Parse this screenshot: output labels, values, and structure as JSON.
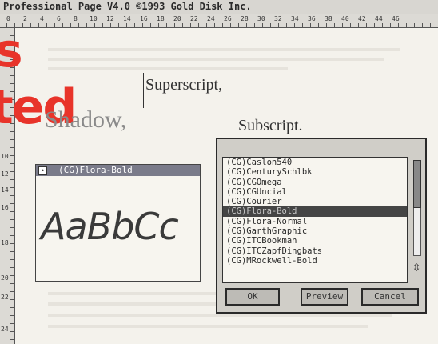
{
  "app_title": "Professional Page V4.0 ©1993 Gold Disk Inc.",
  "ruler": {
    "horizontal": [
      "0",
      "2",
      "4",
      "6",
      "8",
      "10",
      "12",
      "14",
      "16",
      "18",
      "20",
      "22",
      "24",
      "26",
      "28",
      "30",
      "32",
      "34",
      "36",
      "38",
      "40",
      "42",
      "44",
      "46"
    ],
    "vertical": [
      "10",
      "12",
      "14",
      "16",
      "18",
      "20",
      "22",
      "24"
    ]
  },
  "headline": {
    "line1": "s",
    "line2": "ted"
  },
  "document": {
    "shadow": "Shadow,",
    "superscript": "Superscript,",
    "subscript": "Subscript."
  },
  "font_window": {
    "close": "•",
    "title": "(CG)Flora-Bold",
    "sample": "AaBbCc"
  },
  "font_dialog": {
    "fonts": [
      {
        "name": "(CG)Caslon540"
      },
      {
        "name": "(CG)CenturySchlbk"
      },
      {
        "name": "(CG)CGOmega"
      },
      {
        "name": "(CG)CGUncial"
      },
      {
        "name": "(CG)Courier"
      },
      {
        "name": "(CG)Flora-Bold",
        "selected": true
      },
      {
        "name": "(CG)Flora-Normal"
      },
      {
        "name": "(CG)GarthGraphic"
      },
      {
        "name": "(CG)ITCBookman"
      },
      {
        "name": "(CG)ITCZapfDingbats"
      },
      {
        "name": "(CG)MRockwell-Bold"
      }
    ],
    "scroll_arrows": "⇳",
    "ok_label": "OK",
    "preview_label": "Preview",
    "cancel_label": "Cancel"
  },
  "colors": {
    "headline_red": "#e8342a",
    "selection": "#454545",
    "window_title": "#7a7b8a"
  }
}
